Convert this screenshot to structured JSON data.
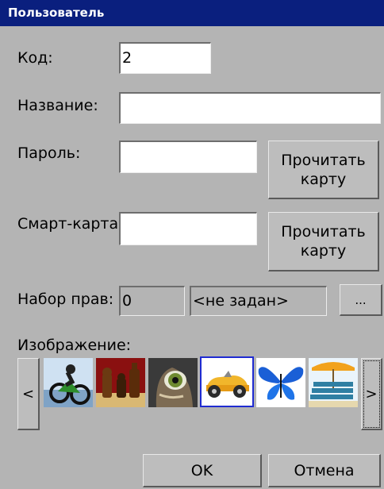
{
  "window": {
    "title": "Пользователь"
  },
  "form": {
    "code_label": "Код:",
    "code_value": "2",
    "name_label": "Название:",
    "name_value": "",
    "password_label": "Пароль:",
    "password_value": "",
    "smartcard_label": "Смарт-карта:",
    "smartcard_value": "",
    "read_card_label_1": "Прочитать карту",
    "read_card_label_2": "Прочитать карту",
    "rights_label": "Набор прав:",
    "rights_id": "0",
    "rights_name": "<не задан>",
    "rights_browse": "...",
    "image_label": "Изображение:"
  },
  "gallery": {
    "prev": "<",
    "next": ">",
    "images": [
      {
        "icon": "motocross-icon"
      },
      {
        "icon": "chess-icon"
      },
      {
        "icon": "cat-eye-icon"
      },
      {
        "icon": "race-car-icon",
        "selected": true
      },
      {
        "icon": "butterfly-icon"
      },
      {
        "icon": "beach-chair-icon"
      }
    ]
  },
  "footer": {
    "ok": "OK",
    "cancel": "Отмена"
  },
  "colors": {
    "title_bg": "#0a1f7e",
    "window_bg": "#b4b4b4",
    "selection": "#1f2bd1"
  }
}
